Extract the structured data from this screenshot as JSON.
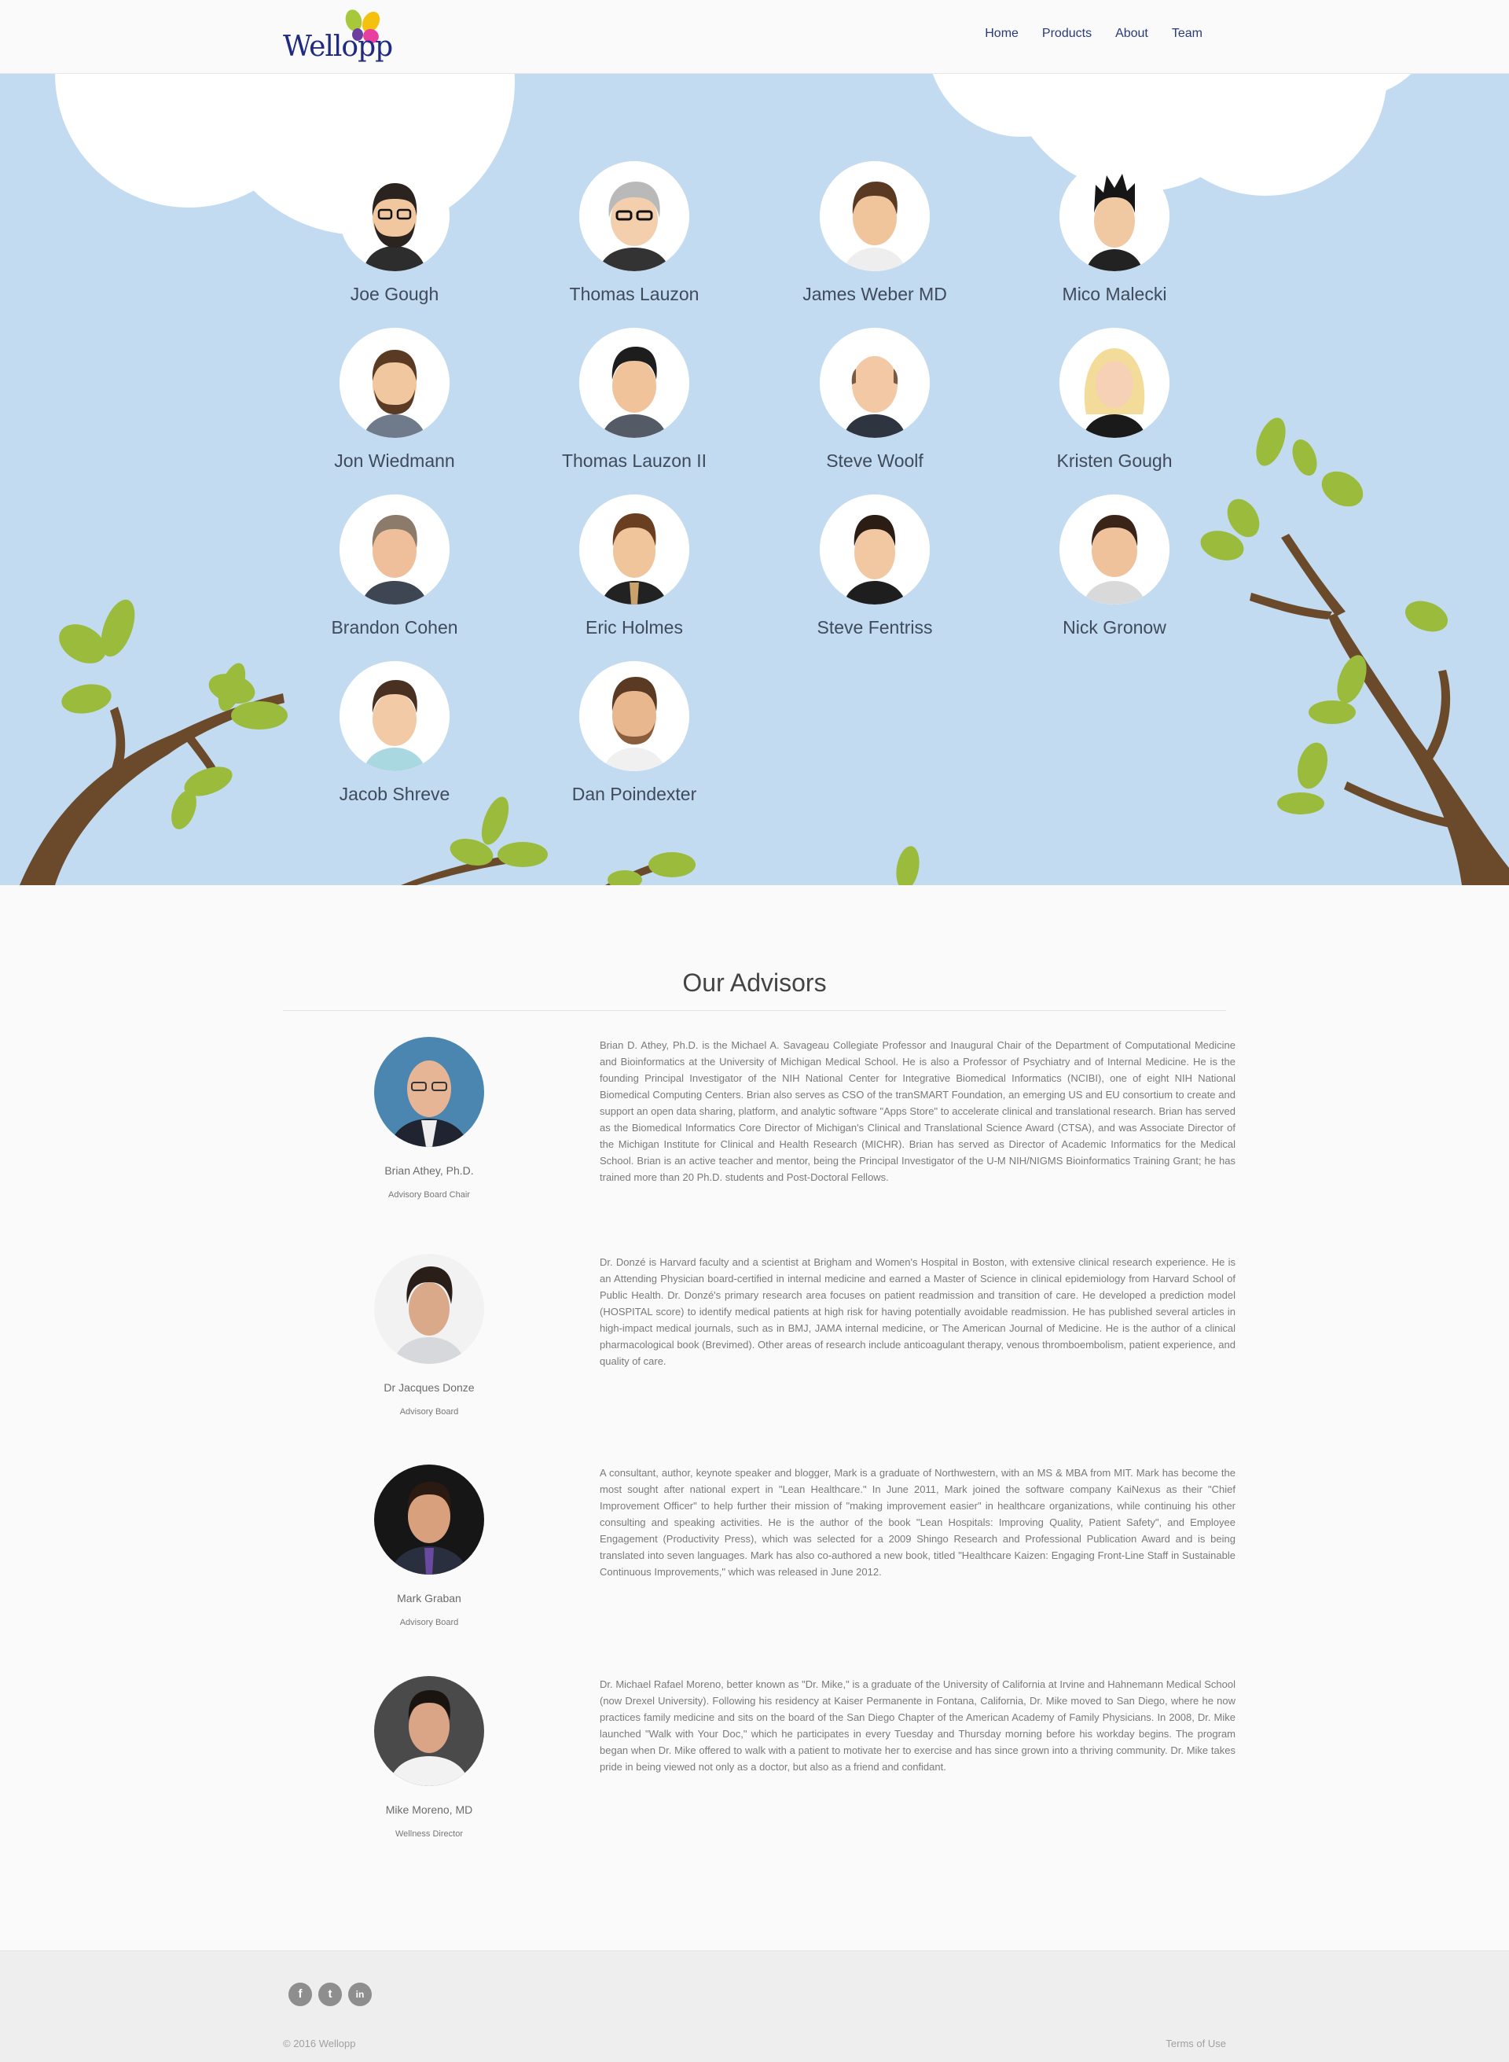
{
  "brand": {
    "name": "Wellopp"
  },
  "nav": {
    "items": [
      {
        "label": "Home"
      },
      {
        "label": "Products"
      },
      {
        "label": "About"
      },
      {
        "label": "Team"
      }
    ]
  },
  "team": {
    "members": [
      {
        "name": "Joe Gough",
        "icon": "avatar-bearded-glasses"
      },
      {
        "name": "Thomas Lauzon",
        "icon": "avatar-gray-glasses"
      },
      {
        "name": "James Weber MD",
        "icon": "avatar-brown-hair"
      },
      {
        "name": "Mico Malecki",
        "icon": "avatar-spiky-hair"
      },
      {
        "name": "Jon Wiedmann",
        "icon": "avatar-bearded"
      },
      {
        "name": "Thomas Lauzon II",
        "icon": "avatar-dark-hair"
      },
      {
        "name": "Steve Woolf",
        "icon": "avatar-bald"
      },
      {
        "name": "Kristen Gough",
        "icon": "avatar-blonde"
      },
      {
        "name": "Brandon Cohen",
        "icon": "avatar-gray-hair"
      },
      {
        "name": "Eric Holmes",
        "icon": "avatar-suit-tie"
      },
      {
        "name": "Steve Fentriss",
        "icon": "avatar-short-hair"
      },
      {
        "name": "Nick Gronow",
        "icon": "avatar-smiling"
      },
      {
        "name": "Jacob Shreve",
        "icon": "avatar-young"
      },
      {
        "name": "Dan Poindexter",
        "icon": "avatar-stubble"
      }
    ]
  },
  "advisors": {
    "title": "Our Advisors",
    "items": [
      {
        "name": "Brian Athey, Ph.D.",
        "role": "Advisory Board Chair",
        "bio": "Brian D. Athey, Ph.D. is the Michael A. Savageau Collegiate Professor and Inaugural Chair of the Department of Computational Medicine and Bioinformatics at the University of Michigan Medical School. He is also a Professor of Psychiatry and of Internal Medicine. He is the founding Principal Investigator of the NIH National Center for Integrative Biomedical Informatics (NCIBI), one of eight NIH National Biomedical Computing Centers. Brian also serves as CSO of the tranSMART Foundation, an emerging US and EU consortium to create and support an open data sharing, platform, and analytic software \"Apps Store\" to accelerate clinical and translational research. Brian has served as the Biomedical Informatics Core Director of Michigan's Clinical and Translational Science Award (CTSA), and was Associate Director of the Michigan Institute for Clinical and Health Research (MICHR). Brian has served as Director of Academic Informatics for the Medical School. Brian is an active teacher and mentor, being the Principal Investigator of the U-M NIH/NIGMS Bioinformatics Training Grant; he has trained more than 20 Ph.D. students and Post-Doctoral Fellows."
      },
      {
        "name": "Dr Jacques Donze",
        "role": "Advisory Board",
        "bio": "Dr. Donzé is Harvard faculty and a scientist at Brigham and Women's Hospital in Boston, with extensive clinical research experience. He is an Attending Physician board-certified in internal medicine and earned a Master of Science in clinical epidemiology from Harvard School of Public Health. Dr. Donzé's primary research area focuses on patient readmission and transition of care. He developed a prediction model (HOSPITAL score) to identify medical patients at high risk for having potentially avoidable readmission. He has published several articles in high-impact medical journals, such as in BMJ, JAMA internal medicine, or The American Journal of Medicine. He is the author of a clinical pharmacological book (Brevimed). Other areas of research include anticoagulant therapy, venous thromboembolism, patient experience, and quality of care."
      },
      {
        "name": "Mark Graban",
        "role": "Advisory Board",
        "bio": "A consultant, author, keynote speaker and blogger, Mark is a graduate of Northwestern, with an MS & MBA from MIT. Mark has become the most sought after national expert in \"Lean Healthcare.\" In June 2011, Mark joined the software company KaiNexus as their \"Chief Improvement Officer\" to help further their mission of \"making improvement easier\" in healthcare organizations, while continuing his other consulting and speaking activities. He is the author of the book \"Lean Hospitals: Improving Quality, Patient Safety\", and Employee Engagement (Productivity Press), which was selected for a 2009 Shingo Research and Professional Publication Award and is being translated into seven languages. Mark has also co-authored a new book, titled \"Healthcare Kaizen: Engaging Front-Line Staff in Sustainable Continuous Improvements,\" which was released in June 2012."
      },
      {
        "name": "Mike Moreno, MD",
        "role": "Wellness Director",
        "bio": "Dr. Michael Rafael Moreno, better known as \"Dr. Mike,\" is a graduate of the University of California at Irvine and Hahnemann Medical School (now Drexel University). Following his residency at Kaiser Permanente in Fontana, California, Dr. Mike moved to San Diego, where he now practices family medicine and sits on the board of the San Diego Chapter of the American Academy of Family Physicians. In 2008, Dr. Mike launched \"Walk with Your Doc,\" which he participates in every Tuesday and Thursday morning before his workday begins. The program began when Dr. Mike offered to walk with a patient to motivate her to exercise and has since grown into a thriving community. Dr. Mike takes pride in being viewed not only as a doctor, but also as a friend and confidant."
      }
    ]
  },
  "footer": {
    "socials": [
      {
        "icon": "facebook-icon",
        "glyph": "f"
      },
      {
        "icon": "twitter-icon",
        "glyph": "t"
      },
      {
        "icon": "linkedin-icon",
        "glyph": "in"
      }
    ],
    "copyright": "© 2016 Wellopp",
    "terms": "Terms of Use"
  },
  "colors": {
    "hero_bg": "#c2dbf0",
    "cloud": "#ffffff",
    "branch": "#6b4a2b",
    "leaf": "#9bbb3d",
    "nav_text": "#2a3a7a",
    "logo_text": "#1f2a80"
  }
}
